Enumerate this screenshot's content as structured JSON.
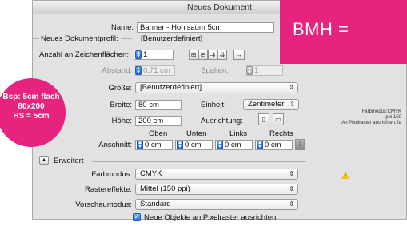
{
  "window": {
    "title": "Neues Dokument"
  },
  "form": {
    "name_label": "Name:",
    "name_value": "Banner - Hohlsaum 5cm",
    "profile_label": "Neues Dokumentprofil:",
    "profile_value": "[Benutzerdefiniert]",
    "artboards_label": "Anzahl an Zeichenflächen:",
    "artboards_value": "1",
    "spacing_label": "Abstand:",
    "spacing_value": "0,71 cm",
    "columns_label": "Spalten:",
    "columns_value": "1",
    "size_label": "Größe:",
    "size_value": "[Benutzerdefiniert]",
    "width_label": "Breite:",
    "width_value": "80 cm",
    "unit_label": "Einheit:",
    "unit_value": "Zentimeter",
    "height_label": "Höhe:",
    "height_value": "200 cm",
    "orientation_label": "Ausrichtung:",
    "bleed_label": "Anschnitt:",
    "bleed_headers": [
      "Oben",
      "Unten",
      "Links",
      "Rechts"
    ],
    "bleed_values": [
      "0 cm",
      "0 cm",
      "0 cm",
      "0 cm"
    ],
    "advanced_label": "Erweitert",
    "colormode_label": "Farbmodus:",
    "colormode_value": "CMYK",
    "raster_label": "Rastereffekte:",
    "raster_value": "Mittel (150 ppi)",
    "preview_label": "Vorschaumodus:",
    "preview_value": "Standard",
    "align_pixel_label": "Neue Objekte an Pixelraster ausrichten"
  },
  "info": {
    "line1": "Farbmodus:CMYK",
    "line2": "ppi:150",
    "line3": "An Pixelraster ausrichten:Ja"
  },
  "overlay": {
    "box_text": "BMH =",
    "circle_lines": [
      "Bsp: 5cm flach",
      "80x200",
      "HS = 5cm"
    ]
  },
  "colors": {
    "accent_pink": "#e6237e",
    "focus_blue": "#2a6fe0"
  }
}
